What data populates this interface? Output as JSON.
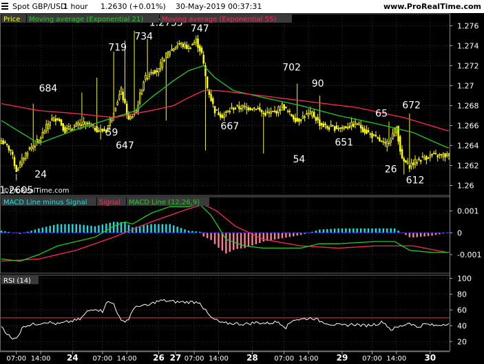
{
  "header": {
    "instrument": "Spot GBP/USD",
    "timeframe": "1 hour",
    "quote": "1.2630 (+0.01%)",
    "datetime": "30-May-2019 00:37:31",
    "site": "www.ProRealTime.com"
  },
  "legends": {
    "price": [
      {
        "label": "Price",
        "color": "#ffff00"
      },
      {
        "label": "Moving average (Exponential 21)",
        "color": "#22cc22"
      },
      {
        "label": "Moving average (Exponential 55)",
        "color": "#ff2a55"
      }
    ],
    "macd": [
      {
        "label": "MACD Line minus Signal",
        "color": "#19e0e8"
      },
      {
        "label": "Signal",
        "color": "#ff2a55"
      },
      {
        "label": "MACD Line (12,26,9)",
        "color": "#22cc22"
      }
    ],
    "rsi": [
      {
        "label": "RSI (14)",
        "color": "#ffffff"
      }
    ]
  },
  "watermark": "©ProRealTime.com",
  "colors": {
    "ema21": "#22cc22",
    "ema55": "#ff2a55",
    "candle": "#ffff00",
    "hist_pos": "#19e0e8",
    "hist_neg": "#ff8095",
    "rsi_line": "#ffffff",
    "rsi_level": "#ff2a55"
  },
  "chart_data": [
    {
      "type": "candlestick",
      "ylim": [
        1.259,
        1.2772
      ],
      "yticks": [
        {
          "v": 1.276,
          "label": "1.276"
        },
        {
          "v": 1.274,
          "label": "1.274"
        },
        {
          "v": 1.272,
          "label": "1.272"
        },
        {
          "v": 1.27,
          "label": "1.27"
        },
        {
          "v": 1.268,
          "label": "1.268"
        },
        {
          "v": 1.266,
          "label": "1.266"
        },
        {
          "v": 1.264,
          "label": "1.264"
        },
        {
          "v": 1.262,
          "label": "1.262"
        },
        {
          "v": 1.26,
          "label": "1.26"
        }
      ],
      "close_anchors": [
        [
          0,
          1.2645
        ],
        [
          5,
          1.2635
        ],
        [
          8,
          1.2615
        ],
        [
          14,
          1.2635
        ],
        [
          20,
          1.2645
        ],
        [
          26,
          1.2665
        ],
        [
          30,
          1.2668
        ],
        [
          34,
          1.2655
        ],
        [
          40,
          1.266
        ],
        [
          46,
          1.2662
        ],
        [
          52,
          1.2655
        ],
        [
          56,
          1.2655
        ],
        [
          60,
          1.2675
        ],
        [
          64,
          1.2695
        ],
        [
          68,
          1.2665
        ],
        [
          72,
          1.2675
        ],
        [
          76,
          1.2705
        ],
        [
          80,
          1.2715
        ],
        [
          84,
          1.2715
        ],
        [
          86,
          1.2725
        ],
        [
          90,
          1.2735
        ],
        [
          95,
          1.2742
        ],
        [
          100,
          1.2738
        ],
        [
          104,
          1.2745
        ],
        [
          107,
          1.2732
        ],
        [
          110,
          1.2698
        ],
        [
          114,
          1.2675
        ],
        [
          118,
          1.267
        ],
        [
          124,
          1.2678
        ],
        [
          130,
          1.2678
        ],
        [
          136,
          1.2678
        ],
        [
          140,
          1.2672
        ],
        [
          146,
          1.2673
        ],
        [
          150,
          1.268
        ],
        [
          154,
          1.2672
        ],
        [
          158,
          1.2665
        ],
        [
          162,
          1.267
        ],
        [
          166,
          1.2672
        ],
        [
          170,
          1.2662
        ],
        [
          174,
          1.2658
        ],
        [
          178,
          1.2658
        ],
        [
          182,
          1.2658
        ],
        [
          186,
          1.266
        ],
        [
          190,
          1.2662
        ],
        [
          194,
          1.2655
        ],
        [
          198,
          1.265
        ],
        [
          202,
          1.2645
        ],
        [
          205,
          1.264
        ],
        [
          208,
          1.2648
        ],
        [
          211,
          1.2658
        ],
        [
          214,
          1.2625
        ],
        [
          218,
          1.262
        ],
        [
          222,
          1.2625
        ],
        [
          226,
          1.2628
        ],
        [
          230,
          1.263
        ],
        [
          234,
          1.263
        ]
      ],
      "highs": [
        [
          8,
          1.2605
        ],
        [
          17,
          1.2682
        ],
        [
          43,
          1.2693
        ],
        [
          51,
          1.2708
        ],
        [
          60,
          1.2734
        ],
        [
          66,
          1.2745
        ],
        [
          71,
          1.2755
        ],
        [
          78,
          1.2747
        ],
        [
          111,
          1.269
        ],
        [
          158,
          1.2702
        ],
        [
          170,
          1.269
        ],
        [
          207,
          1.2664
        ],
        [
          218,
          1.2672
        ]
      ],
      "lows": [
        [
          48,
          1.2659
        ],
        [
          53,
          1.2646
        ],
        [
          88,
          1.2665
        ],
        [
          109,
          1.2635
        ],
        [
          140,
          1.2632
        ],
        [
          215,
          1.2611
        ]
      ],
      "annotations": [
        {
          "label": "1.2605",
          "i": 8,
          "v": 1.2601,
          "pos": "below"
        },
        {
          "label": "24",
          "i": 21,
          "v": 1.2617,
          "pos": "below"
        },
        {
          "label": "684",
          "i": 25,
          "v": 1.2692,
          "pos": "above"
        },
        {
          "label": "719",
          "i": 62,
          "v": 1.2733,
          "pos": "above"
        },
        {
          "label": "59",
          "i": 59,
          "v": 1.2659,
          "pos": "below"
        },
        {
          "label": "647",
          "i": 66,
          "v": 1.2646,
          "pos": "below"
        },
        {
          "label": "734",
          "i": 76,
          "v": 1.2744,
          "pos": "above"
        },
        {
          "label": "1.2755",
          "i": 88,
          "v": 1.2758,
          "pos": "above"
        },
        {
          "label": "747",
          "i": 106,
          "v": 1.2752,
          "pos": "above"
        },
        {
          "label": "667",
          "i": 122,
          "v": 1.2665,
          "pos": "below"
        },
        {
          "label": "702",
          "i": 155,
          "v": 1.2713,
          "pos": "above"
        },
        {
          "label": "54",
          "i": 159,
          "v": 1.2632,
          "pos": "below"
        },
        {
          "label": "90",
          "i": 169,
          "v": 1.2697,
          "pos": "above"
        },
        {
          "label": "651",
          "i": 183,
          "v": 1.2649,
          "pos": "below"
        },
        {
          "label": "65",
          "i": 203,
          "v": 1.2667,
          "pos": "above"
        },
        {
          "label": "672",
          "i": 219,
          "v": 1.2675,
          "pos": "above"
        },
        {
          "label": "26",
          "i": 208,
          "v": 1.2622,
          "pos": "below"
        },
        {
          "label": "612",
          "i": 221,
          "v": 1.2611,
          "pos": "below"
        }
      ],
      "ema21_anchors": [
        [
          0,
          1.2665
        ],
        [
          20,
          1.2642
        ],
        [
          40,
          1.2656
        ],
        [
          60,
          1.2668
        ],
        [
          72,
          1.2675
        ],
        [
          80,
          1.2688
        ],
        [
          92,
          1.2705
        ],
        [
          100,
          1.2715
        ],
        [
          108,
          1.272
        ],
        [
          114,
          1.2708
        ],
        [
          124,
          1.2695
        ],
        [
          140,
          1.2688
        ],
        [
          160,
          1.268
        ],
        [
          180,
          1.267
        ],
        [
          200,
          1.2662
        ],
        [
          220,
          1.2653
        ],
        [
          238,
          1.2638
        ]
      ],
      "ema55_anchors": [
        [
          0,
          1.2682
        ],
        [
          20,
          1.2675
        ],
        [
          40,
          1.2672
        ],
        [
          60,
          1.2668
        ],
        [
          80,
          1.2675
        ],
        [
          92,
          1.268
        ],
        [
          100,
          1.2688
        ],
        [
          108,
          1.2695
        ],
        [
          116,
          1.2695
        ],
        [
          130,
          1.2692
        ],
        [
          160,
          1.2685
        ],
        [
          190,
          1.2678
        ],
        [
          215,
          1.2668
        ],
        [
          238,
          1.2655
        ]
      ]
    },
    {
      "type": "macd",
      "ylim": [
        -0.00185,
        0.00165
      ],
      "yticks": [
        {
          "v": 0.001,
          "label": "0.001"
        },
        {
          "v": 0,
          "label": "0"
        },
        {
          "v": -0.001,
          "label": "-0.001"
        }
      ],
      "macd_anchors": [
        [
          0,
          -0.0012
        ],
        [
          10,
          -0.0013
        ],
        [
          20,
          -0.001
        ],
        [
          30,
          -0.0006
        ],
        [
          50,
          -0.0002
        ],
        [
          60,
          0.0003
        ],
        [
          66,
          0.0005
        ],
        [
          70,
          0.0004
        ],
        [
          80,
          0.0009
        ],
        [
          90,
          0.0012
        ],
        [
          100,
          0.0012
        ],
        [
          106,
          0.0013
        ],
        [
          112,
          0.0008
        ],
        [
          120,
          -0.0003
        ],
        [
          130,
          -0.0006
        ],
        [
          140,
          -0.0007
        ],
        [
          160,
          -0.0007
        ],
        [
          170,
          -0.0005
        ],
        [
          180,
          -0.0005
        ],
        [
          200,
          -0.0004
        ],
        [
          210,
          -0.0004
        ],
        [
          218,
          -0.0008
        ],
        [
          230,
          -0.0009
        ],
        [
          238,
          -0.0009
        ]
      ],
      "signal_anchors": [
        [
          0,
          -0.0013
        ],
        [
          20,
          -0.0012
        ],
        [
          40,
          -0.0008
        ],
        [
          60,
          -0.0002
        ],
        [
          80,
          0.0005
        ],
        [
          100,
          0.0011
        ],
        [
          108,
          0.0013
        ],
        [
          115,
          0.001
        ],
        [
          125,
          0.0003
        ],
        [
          140,
          -0.0003
        ],
        [
          160,
          -0.0006
        ],
        [
          180,
          -0.0007
        ],
        [
          200,
          -0.0006
        ],
        [
          220,
          -0.0006
        ],
        [
          238,
          -0.0009
        ]
      ]
    },
    {
      "type": "line",
      "ylim": [
        8,
        104
      ],
      "yticks": [
        {
          "v": 100,
          "label": "100"
        },
        {
          "v": 80,
          "label": "80"
        },
        {
          "v": 60,
          "label": "60"
        },
        {
          "v": 40,
          "label": "40"
        },
        {
          "v": 20,
          "label": "20"
        }
      ],
      "level": 50,
      "rsi_anchors": [
        [
          0,
          40
        ],
        [
          3,
          30
        ],
        [
          6,
          22
        ],
        [
          9,
          28
        ],
        [
          12,
          40
        ],
        [
          18,
          42
        ],
        [
          24,
          45
        ],
        [
          30,
          42
        ],
        [
          36,
          45
        ],
        [
          42,
          48
        ],
        [
          46,
          58
        ],
        [
          50,
          62
        ],
        [
          54,
          58
        ],
        [
          56,
          70
        ],
        [
          60,
          68
        ],
        [
          64,
          45
        ],
        [
          68,
          48
        ],
        [
          70,
          60
        ],
        [
          74,
          66
        ],
        [
          78,
          65
        ],
        [
          82,
          70
        ],
        [
          86,
          72
        ],
        [
          90,
          71
        ],
        [
          94,
          70
        ],
        [
          98,
          70
        ],
        [
          102,
          70
        ],
        [
          106,
          70
        ],
        [
          108,
          62
        ],
        [
          112,
          50
        ],
        [
          118,
          43
        ],
        [
          124,
          43
        ],
        [
          130,
          42
        ],
        [
          136,
          44
        ],
        [
          142,
          43
        ],
        [
          148,
          45
        ],
        [
          152,
          38
        ],
        [
          156,
          48
        ],
        [
          160,
          48
        ],
        [
          166,
          50
        ],
        [
          170,
          46
        ],
        [
          176,
          42
        ],
        [
          182,
          40
        ],
        [
          188,
          42
        ],
        [
          194,
          40
        ],
        [
          200,
          42
        ],
        [
          204,
          45
        ],
        [
          208,
          35
        ],
        [
          214,
          40
        ],
        [
          218,
          44
        ],
        [
          222,
          38
        ],
        [
          226,
          42
        ],
        [
          232,
          40
        ],
        [
          238,
          43
        ]
      ]
    },
    {
      "type": "time_axis",
      "ticks": [
        {
          "i": 8,
          "label": "07:00",
          "bold": false
        },
        {
          "i": 21,
          "label": "14:00",
          "bold": false
        },
        {
          "i": 38,
          "label": "24",
          "bold": true
        },
        {
          "i": 54,
          "label": "07:00",
          "bold": false
        },
        {
          "i": 67,
          "label": "14:00",
          "bold": false
        },
        {
          "i": 84,
          "label": "26",
          "bold": true
        },
        {
          "i": 93,
          "label": "27",
          "bold": true
        },
        {
          "i": 103,
          "label": "07:00",
          "bold": false
        },
        {
          "i": 116,
          "label": "14:00",
          "bold": false
        },
        {
          "i": 134,
          "label": "28",
          "bold": true
        },
        {
          "i": 151,
          "label": "07:00",
          "bold": false
        },
        {
          "i": 164,
          "label": "14:00",
          "bold": false
        },
        {
          "i": 182,
          "label": "29",
          "bold": true
        },
        {
          "i": 198,
          "label": "07:00",
          "bold": false
        },
        {
          "i": 211,
          "label": "14:00",
          "bold": false
        },
        {
          "i": 229,
          "label": "30",
          "bold": true
        }
      ]
    }
  ]
}
